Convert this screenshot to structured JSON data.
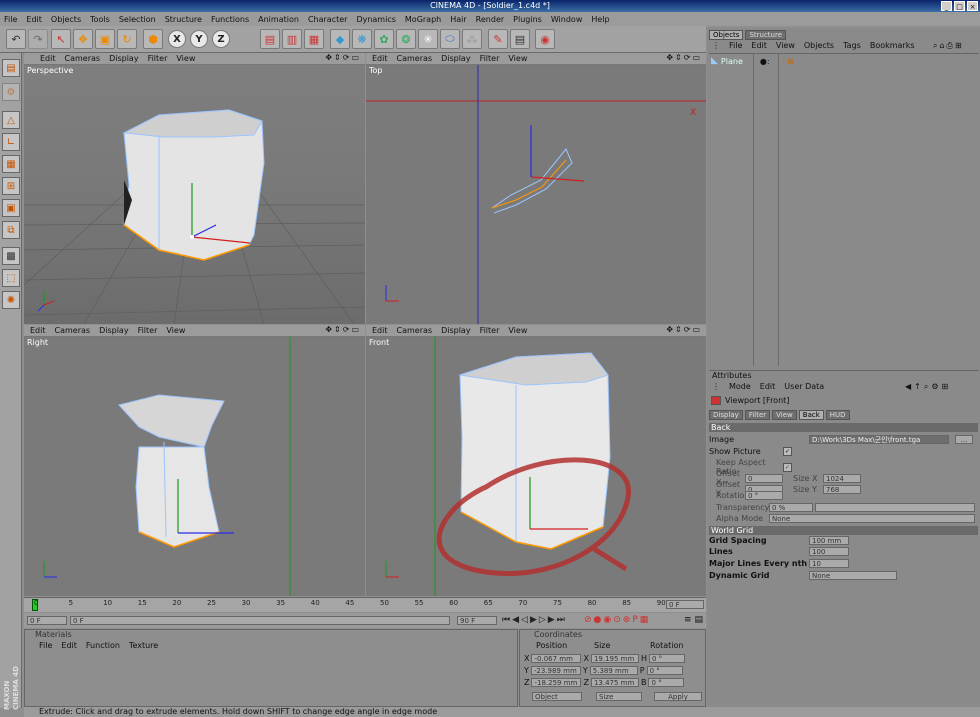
{
  "window": {
    "title": "CINEMA 4D - [Soldier_1.c4d *]"
  },
  "menu": [
    "File",
    "Edit",
    "Objects",
    "Tools",
    "Selection",
    "Structure",
    "Functions",
    "Animation",
    "Character",
    "Dynamics",
    "MoGraph",
    "Hair",
    "Render",
    "Plugins",
    "Window",
    "Help"
  ],
  "viewport_menu": [
    "Edit",
    "Cameras",
    "Display",
    "Filter",
    "View"
  ],
  "viewports": {
    "perspective": {
      "label": "Perspective"
    },
    "top": {
      "label": "Top"
    },
    "right": {
      "label": "Right"
    },
    "front": {
      "label": "Front"
    }
  },
  "axis": {
    "x": "X",
    "y": "Y",
    "z": "Z"
  },
  "objects_panel": {
    "tabs": [
      "Objects",
      "Structure"
    ],
    "menu": [
      "File",
      "Edit",
      "View",
      "Objects",
      "Tags",
      "Bookmarks"
    ],
    "item": "Plane"
  },
  "attributes": {
    "header": "Attributes",
    "menu": [
      "Mode",
      "Edit",
      "User Data"
    ],
    "title": "Viewport [Front]",
    "tabs": [
      "Display",
      "Filter",
      "View",
      "Back",
      "HUD"
    ],
    "section_back": "Back",
    "image_label": "Image",
    "image_value": "D:\\Work\\3Ds Max\\군인\\front.tga",
    "image_btn": "...",
    "show_picture": "Show Picture",
    "keep_aspect": "Keep Aspect Ratio",
    "offset_x_label": "Offset X",
    "offset_x": "0",
    "size_x_label": "Size X",
    "size_x": "1024",
    "offset_y_label": "Offset Y",
    "offset_y": "0",
    "size_y_label": "Size Y",
    "size_y": "768",
    "rotation_label": "Rotation",
    "rotation": "0 °",
    "transparency_label": "Transparency",
    "transparency": "0 %",
    "alpha_label": "Alpha Mode",
    "alpha": "None",
    "section_grid": "World Grid",
    "grid_spacing_label": "Grid Spacing",
    "grid_spacing": "100 mm",
    "lines_label": "Lines",
    "lines": "100",
    "major_label": "Major Lines Every nth",
    "major": "10",
    "dynamic_label": "Dynamic Grid",
    "dynamic": "None"
  },
  "timeline": {
    "ticks": [
      "0",
      "5",
      "10",
      "15",
      "20",
      "25",
      "30",
      "35",
      "40",
      "45",
      "50",
      "55",
      "60",
      "65",
      "70",
      "75",
      "80",
      "85",
      "90"
    ],
    "frame_field": "0 F",
    "start": "0 F",
    "end": "90 F",
    "start_field": "0 F"
  },
  "materials": {
    "title": "Materials",
    "menu": [
      "File",
      "Edit",
      "Function",
      "Texture"
    ]
  },
  "coordinates": {
    "title": "Coordinates",
    "headers": [
      "Position",
      "Size",
      "Rotation"
    ],
    "rows": [
      {
        "axis": "X",
        "pos": "-0.067 mm",
        "size_axis": "X",
        "size": "19.195 mm",
        "rot_axis": "H",
        "rot": "0 °"
      },
      {
        "axis": "Y",
        "pos": "-23.989 mm",
        "size_axis": "Y",
        "size": "5.389 mm",
        "rot_axis": "P",
        "rot": "0 °"
      },
      {
        "axis": "Z",
        "pos": "-18.259 mm",
        "size_axis": "Z",
        "size": "13.475 mm",
        "rot_axis": "B",
        "rot": "0 °"
      }
    ],
    "mode": "Object",
    "size_mode": "Size",
    "apply": "Apply"
  },
  "brand": "MAXON CINEMA 4D",
  "status": "Extrude: Click and drag to extrude elements. Hold down SHIFT to change edge angle in edge mode",
  "colors": {
    "viewport": "#7a7a7a",
    "highlight": "#c03030",
    "edge": "#ff9900",
    "wire": "#9cc4ff"
  }
}
